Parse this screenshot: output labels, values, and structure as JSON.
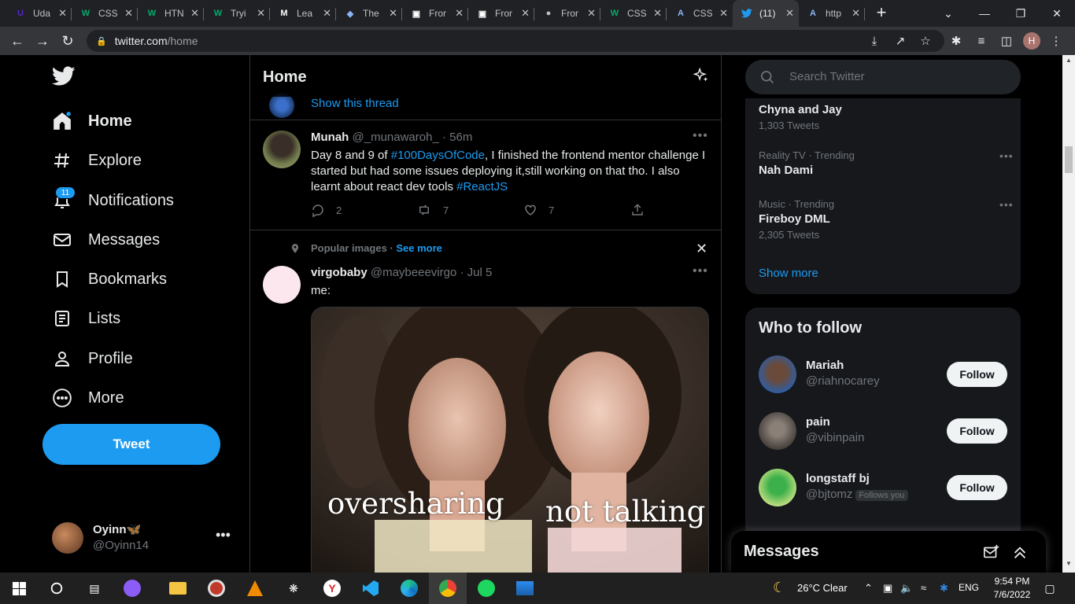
{
  "browser": {
    "tabs": [
      {
        "label": "Uda",
        "fav": "U",
        "color": "#5624d0"
      },
      {
        "label": "CSS",
        "fav": "W",
        "color": "#04aa6d"
      },
      {
        "label": "HTN",
        "fav": "W",
        "color": "#04aa6d"
      },
      {
        "label": "Tryi",
        "fav": "W",
        "color": "#04aa6d"
      },
      {
        "label": "Lea",
        "fav": "M",
        "color": "#ffffff"
      },
      {
        "label": "The",
        "fav": "◆",
        "color": "#8ab4f8"
      },
      {
        "label": "Fror",
        "fav": "▣",
        "color": "#ffffff"
      },
      {
        "label": "Fror",
        "fav": "▣",
        "color": "#ffffff"
      },
      {
        "label": "Fror",
        "fav": "●",
        "color": "#bdc1c6"
      },
      {
        "label": "CSS",
        "fav": "W",
        "color": "#04aa6d"
      },
      {
        "label": "CSS",
        "fav": "A",
        "color": "#8ab4f8"
      },
      {
        "label": "(11)",
        "fav": "bird",
        "color": "#1d9bf0"
      },
      {
        "label": "http",
        "fav": "A",
        "color": "#8ab4f8"
      }
    ],
    "url_domain": "twitter.com",
    "url_path": "/home",
    "profile_initial": "H"
  },
  "nav": {
    "items": [
      {
        "label": "Home",
        "icon": "home-icon"
      },
      {
        "label": "Explore",
        "icon": "hashtag-icon"
      },
      {
        "label": "Notifications",
        "icon": "bell-icon"
      },
      {
        "label": "Messages",
        "icon": "envelope-icon"
      },
      {
        "label": "Bookmarks",
        "icon": "bookmark-icon"
      },
      {
        "label": "Lists",
        "icon": "list-icon"
      },
      {
        "label": "Profile",
        "icon": "person-icon"
      },
      {
        "label": "More",
        "icon": "more-circle-icon"
      }
    ],
    "notifications_badge": "11",
    "tweet_button": "Tweet",
    "account": {
      "name": "Oyinn🦋",
      "handle": "@Oyinn14"
    }
  },
  "timeline": {
    "title": "Home",
    "show_thread": "Show this thread",
    "tweet1": {
      "name": "Munah",
      "handle": "@_munawaroh_",
      "time": "· 56m",
      "text_a": "Day 8 and 9 of ",
      "tag1": "#100DaysOfCode",
      "text_b": ", I finished the frontend mentor challenge I started but had some issues deploying it,still working on that tho. I also learnt about react dev tools ",
      "tag2": "#ReactJS",
      "replies": "2",
      "retweets": "7",
      "likes": "7"
    },
    "popular": {
      "label": "Popular images · ",
      "see_more": "See more"
    },
    "tweet2": {
      "name": "virgobaby",
      "handle": "@maybeeevirgo",
      "time": "· Jul 5",
      "text": "me:",
      "caption_left": "oversharing",
      "caption_right": "not talking"
    }
  },
  "sidebar": {
    "search_placeholder": "Search Twitter",
    "trends": [
      {
        "meta": "",
        "name": "Chyna and Jay",
        "count": "1,303 Tweets"
      },
      {
        "meta": "Reality TV · Trending",
        "name": "Nah Dami",
        "count": ""
      },
      {
        "meta": "Music · Trending",
        "name": "Fireboy DML",
        "count": "2,305 Tweets"
      }
    ],
    "show_more": "Show more",
    "who_to_follow": "Who to follow",
    "follows": [
      {
        "name": "Mariah",
        "handle": "@riahnocarey",
        "button": "Follow",
        "note": ""
      },
      {
        "name": "pain",
        "handle": "@vibinpain",
        "button": "Follow",
        "note": ""
      },
      {
        "name": "longstaff bj",
        "handle": "@bjtomz",
        "button": "Follow",
        "note": "Follows you"
      }
    ],
    "messages_title": "Messages"
  },
  "taskbar": {
    "weather": "26°C  Clear",
    "lang": "ENG",
    "time": "9:54 PM",
    "date": "7/6/2022"
  }
}
